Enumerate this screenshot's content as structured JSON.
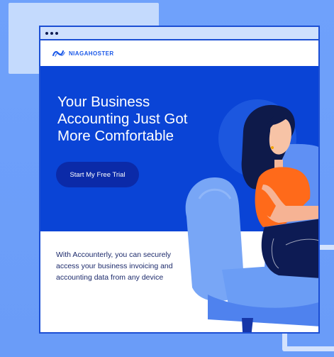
{
  "brand": {
    "name": "NIAGAHOSTER",
    "logo_icon": "niagahoster-logo-icon"
  },
  "hero": {
    "title_lines": [
      "Your Business",
      "Accounting Just Got",
      "More Comfortable"
    ],
    "cta_label": "Start My Free Trial"
  },
  "body": {
    "lines": [
      "With Accounterly, you can securely",
      "access your business invoicing and",
      "accounting data from any device"
    ]
  },
  "colors": {
    "background": "#6fa1fb",
    "hero_blue": "#0a44d6",
    "cta_dark": "#0b2aa8",
    "brand_blue": "#1a58e8",
    "shirt_orange": "#ff6a1a"
  }
}
